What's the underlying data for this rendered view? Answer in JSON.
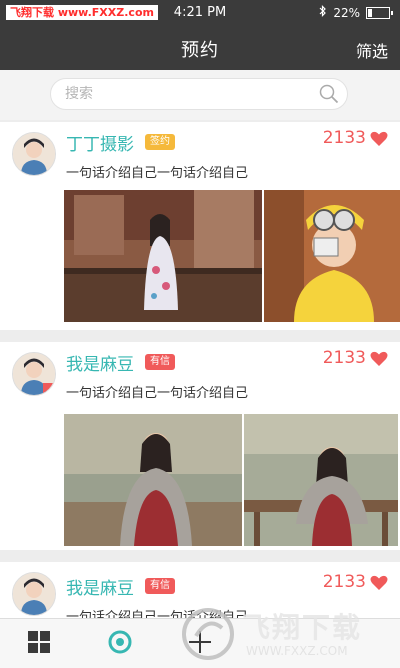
{
  "status_bar": {
    "carrier": "飞翔下载 www.FXXZ.com",
    "time": "4:21 PM",
    "bluetooth_icon": "bluetooth-icon",
    "battery": "22%",
    "battery_level": 0.22
  },
  "nav": {
    "title": "预约",
    "filter_label": "筛选"
  },
  "search": {
    "placeholder": "搜索"
  },
  "cards": [
    {
      "name": "丁丁摄影",
      "badge": "签约",
      "badge_color": "#f5b93b",
      "count": "2133",
      "intro": "一句话介绍自己一句话介绍自己"
    },
    {
      "name": "我是麻豆",
      "badge": "有信",
      "badge_color": "#f05a5a",
      "count": "2133",
      "intro": "一句话介绍自己一句话介绍自己"
    },
    {
      "name": "我是麻豆",
      "badge": "有信",
      "badge_color": "#f05a5a",
      "count": "2133",
      "intro": "一句话介绍自己一句话介绍自己"
    }
  ],
  "tabbar": {
    "tabs": [
      "grid-icon",
      "discover-icon",
      "plus-icon",
      "message-icon",
      "profile-icon"
    ]
  },
  "watermark": {
    "text": "飞翔下载",
    "url": "WWW.FXXZ.COM"
  },
  "colors": {
    "accent": "#37b7b2",
    "heart": "#f05a5a",
    "bar": "#3b3b3b"
  }
}
